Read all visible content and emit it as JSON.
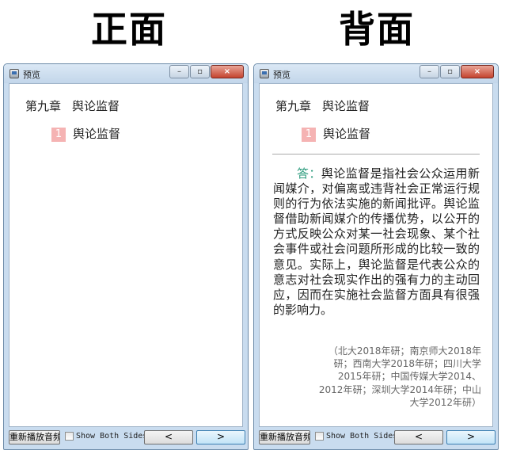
{
  "headings": {
    "front": "正面",
    "back": "背面"
  },
  "window": {
    "title": "预览",
    "controls": {
      "minimize": "–",
      "maximize": "▫",
      "close": "×"
    }
  },
  "card": {
    "chapter_num": "第九章",
    "chapter_title": "舆论监督",
    "section_num": "1",
    "section_title": "舆论监督"
  },
  "answer": {
    "prefix": "答：",
    "text": "舆论监督是指社会公众运用新闻媒介，对偏离或违背社会正常运行规则的行为依法实施的新闻批评。舆论监督借助新闻媒介的传播优势，以公开的方式反映公众对某一社会现象、某个社会事件或社会问题所形成的比较一致的意见。实际上，舆论监督是代表公众的意志对社会现实作出的强有力的主动回应，因而在实施社会监督方面具有很强的影响力。",
    "source": "（北大2018年研；南京师大2018年研；西南大学2018年研；四川大学2015年研；中国传媒大学2014、2012年研；深圳大学2014年研；中山大学2012年研）"
  },
  "footer": {
    "replay_label": "重新播放音频",
    "show_both_label": "Show Both Sides",
    "prev_label": "<",
    "next_label": ">"
  },
  "colors": {
    "answer_prefix": "#2e9c7e",
    "badge": "#f5b3b3",
    "window_frame": "#c9dcef"
  }
}
